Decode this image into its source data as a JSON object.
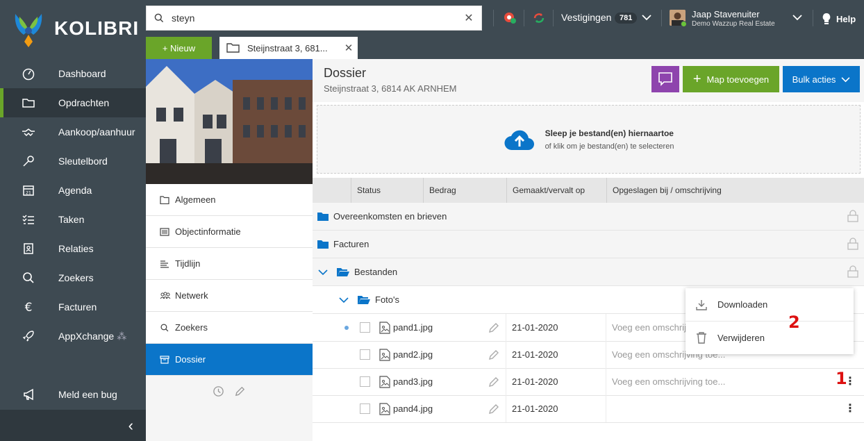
{
  "app": {
    "logo_text": "KOLIBRI"
  },
  "sidebar": {
    "items": [
      {
        "label": "Dashboard",
        "icon": "dashboard-icon"
      },
      {
        "label": "Opdrachten",
        "icon": "folder-open-icon",
        "active": true
      },
      {
        "label": "Aankoop/aanhuur",
        "icon": "handshake-icon"
      },
      {
        "label": "Sleutelbord",
        "icon": "key-icon"
      },
      {
        "label": "Agenda",
        "icon": "calendar-icon"
      },
      {
        "label": "Taken",
        "icon": "tasks-icon"
      },
      {
        "label": "Relaties",
        "icon": "contacts-icon"
      },
      {
        "label": "Zoekers",
        "icon": "search-icon"
      },
      {
        "label": "Facturen",
        "icon": "euro-icon"
      },
      {
        "label": "AppXchange",
        "icon": "rocket-icon"
      }
    ],
    "bug_label": "Meld een bug"
  },
  "topbar": {
    "search_value": "steyn",
    "vestigingen_label": "Vestigingen",
    "vestigingen_count": "781",
    "user_name": "Jaap Stavenuiter",
    "user_company": "Demo Wazzup Real Estate",
    "help_label": "Help"
  },
  "tabs": {
    "new_label": "+ Nieuw",
    "open_tab": "Steijnstraat 3, 681..."
  },
  "leftpanel": {
    "items": [
      {
        "label": "Algemeen",
        "icon": "folder-icon"
      },
      {
        "label": "Objectinformatie",
        "icon": "list-icon"
      },
      {
        "label": "Tijdlijn",
        "icon": "timeline-icon"
      },
      {
        "label": "Netwerk",
        "icon": "network-icon"
      },
      {
        "label": "Zoekers",
        "icon": "search-icon"
      },
      {
        "label": "Dossier",
        "icon": "archive-icon",
        "active": true
      }
    ]
  },
  "dossier": {
    "title": "Dossier",
    "subtitle": "Steijnstraat 3, 6814 AK ARNHEM",
    "map_button": "Map toevoegen",
    "bulk_button": "Bulk acties",
    "drop_title": "Sleep je bestand(en) hiernaartoe",
    "drop_sub": "of klik om je bestand(en) te selecteren"
  },
  "table": {
    "headers": [
      "Status",
      "Bedrag",
      "Gemaakt/vervalt op",
      "Opgeslagen bij / omschrijving"
    ],
    "folders": [
      "Overeenkomsten en brieven",
      "Facturen",
      "Bestanden",
      "Foto's"
    ],
    "files": [
      {
        "name": "pand1.jpg",
        "date": "21-01-2020",
        "desc": "Voeg een omschrijving toe..."
      },
      {
        "name": "pand2.jpg",
        "date": "21-01-2020",
        "desc": "Voeg een omschrijving toe..."
      },
      {
        "name": "pand3.jpg",
        "date": "21-01-2020",
        "desc": "Voeg een omschrijving toe..."
      },
      {
        "name": "pand4.jpg",
        "date": "21-01-2020",
        "desc": ""
      }
    ]
  },
  "context_menu": {
    "download": "Downloaden",
    "delete": "Verwijderen"
  },
  "annotations": {
    "one": "1",
    "two": "2"
  },
  "colors": {
    "sidebar": "#3e4a52",
    "green": "#6aa529",
    "blue": "#0b75c9",
    "purple": "#8e44ad"
  }
}
